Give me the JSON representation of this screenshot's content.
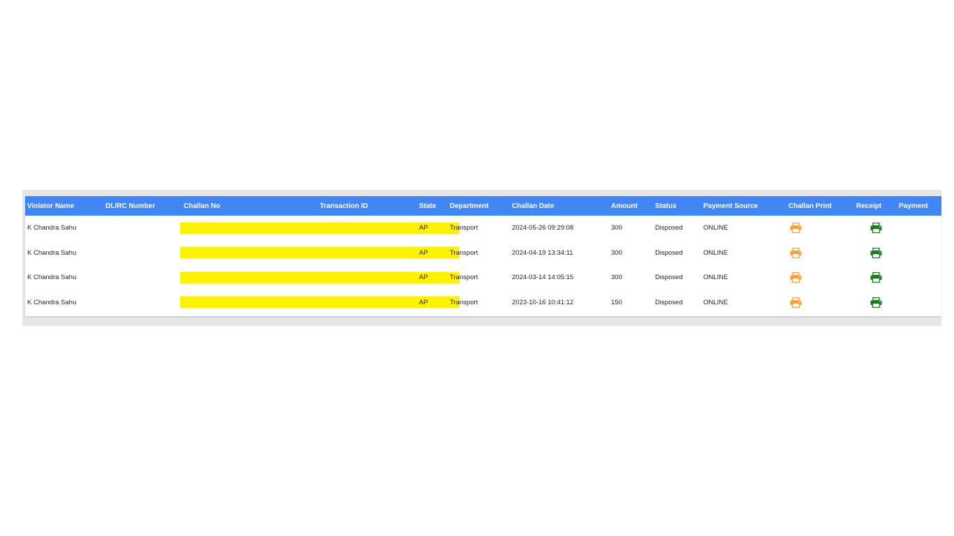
{
  "table": {
    "headers": {
      "violator_name": "Violator Name",
      "dl_rc_number": "DL/RC Number",
      "challan_no": "Challan No",
      "transaction_id": "Transaction ID",
      "state": "State",
      "department": "Department",
      "challan_date": "Challan Date",
      "amount": "Amount",
      "status": "Status",
      "payment_source": "Payment Source",
      "challan_print": "Challan Print",
      "receipt": "Receipt",
      "payment": "Payment"
    },
    "rows": [
      {
        "violator_name": "K Chandra Sahu",
        "state": "AP",
        "department": "Transport",
        "challan_date": "2024-05-26 09:29:08",
        "amount": "300",
        "status": "Disposed",
        "payment_source": "ONLINE"
      },
      {
        "violator_name": "K Chandra Sahu",
        "state": "AP",
        "department": "Transport",
        "challan_date": "2024-04-19 13:34:11",
        "amount": "300",
        "status": "Disposed",
        "payment_source": "ONLINE"
      },
      {
        "violator_name": "K Chandra Sahu",
        "state": "AP",
        "department": "Transport",
        "challan_date": "2024-03-14 14:05:15",
        "amount": "300",
        "status": "Disposed",
        "payment_source": "ONLINE"
      },
      {
        "violator_name": "K Chandra Sahu",
        "state": "AP",
        "department": "Transport",
        "challan_date": "2023-10-16 10:41:12",
        "amount": "150",
        "status": "Disposed",
        "payment_source": "ONLINE"
      }
    ]
  },
  "colors": {
    "header_bg": "#4286f4",
    "redaction": "#fff200",
    "challan_print_icon": "#f7a23c",
    "receipt_icon": "#1a7a1a"
  },
  "icons": {
    "challan_print": "printer-icon",
    "receipt": "printer-icon"
  }
}
